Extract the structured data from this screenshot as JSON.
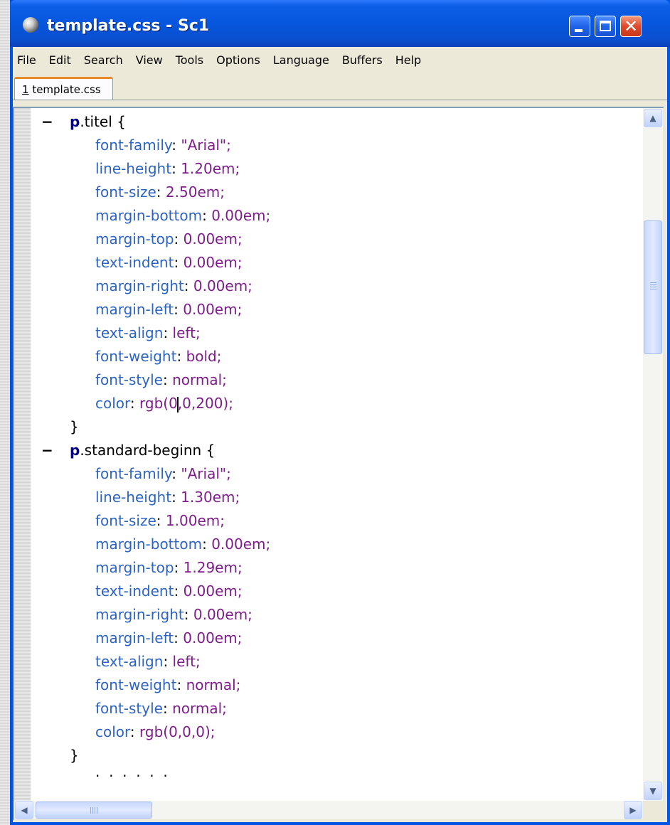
{
  "window": {
    "title": "template.css - Sc1"
  },
  "menu": [
    "File",
    "Edit",
    "Search",
    "View",
    "Tools",
    "Options",
    "Language",
    "Buffers",
    "Help"
  ],
  "tab": {
    "index": "1",
    "name": " template.css"
  },
  "code": {
    "blocks": [
      {
        "tag": "p",
        "selector_rest": ".titel {",
        "props": [
          {
            "name": "font-family",
            "value": "\"Arial\";"
          },
          {
            "name": "line-height",
            "value": "1.20em;"
          },
          {
            "name": "font-size",
            "value": "2.50em;"
          },
          {
            "name": "margin-bottom",
            "value": "0.00em;"
          },
          {
            "name": "margin-top",
            "value": "0.00em;"
          },
          {
            "name": "text-indent",
            "value": "0.00em;"
          },
          {
            "name": "margin-right",
            "value": "0.00em;"
          },
          {
            "name": "margin-left",
            "value": "0.00em;"
          },
          {
            "name": "text-align",
            "value": "left;"
          },
          {
            "name": "font-weight",
            "value": "bold;"
          },
          {
            "name": "font-style",
            "value": "normal;"
          },
          {
            "name": "color",
            "value_before_caret": "rgb(0",
            "value_after_caret": ",0,200);"
          }
        ],
        "close": "}"
      },
      {
        "tag": "p",
        "selector_rest": ".standard-beginn {",
        "props": [
          {
            "name": "font-family",
            "value": "\"Arial\";"
          },
          {
            "name": "line-height",
            "value": "1.30em;"
          },
          {
            "name": "font-size",
            "value": "1.00em;"
          },
          {
            "name": "margin-bottom",
            "value": "0.00em;"
          },
          {
            "name": "margin-top",
            "value": "1.29em;"
          },
          {
            "name": "text-indent",
            "value": "0.00em;"
          },
          {
            "name": "margin-right",
            "value": "0.00em;"
          },
          {
            "name": "margin-left",
            "value": "0.00em;"
          },
          {
            "name": "text-align",
            "value": "left;"
          },
          {
            "name": "font-weight",
            "value": "normal;"
          },
          {
            "name": "font-style",
            "value": "normal;"
          },
          {
            "name": "color",
            "value": "rgb(0,0,0);"
          }
        ],
        "close": "}"
      }
    ],
    "partial_line": ".  .  .  .  .  ."
  },
  "fold_marker": "−",
  "colors": {
    "selector_tag": "#00007f",
    "property": "#2d63c4",
    "value": "#7d1d8a"
  }
}
